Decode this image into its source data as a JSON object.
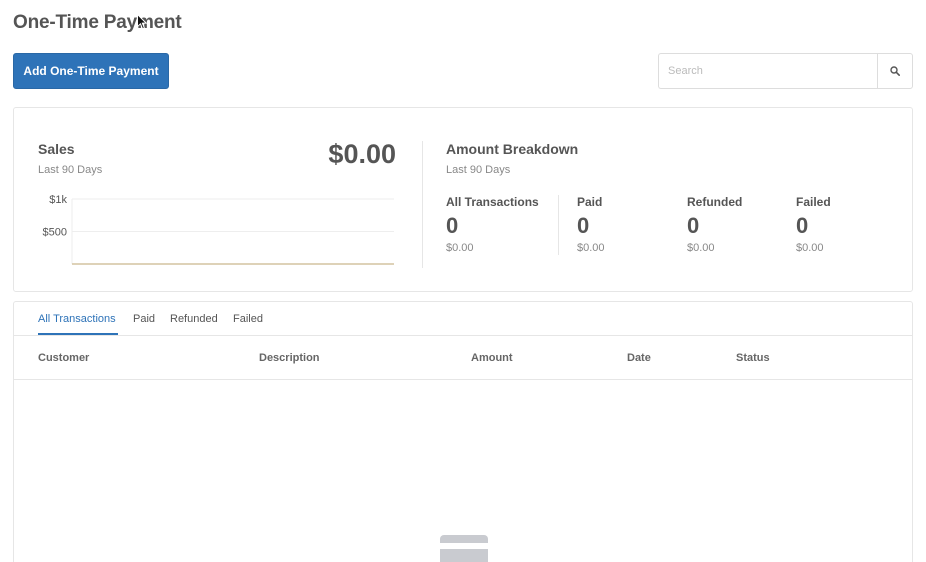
{
  "page": {
    "title": "One-Time Payment"
  },
  "toolbar": {
    "add_label": "Add One-Time Payment"
  },
  "search": {
    "placeholder": "Search",
    "value": ""
  },
  "sales": {
    "title": "Sales",
    "subtitle": "Last 90 Days",
    "total": "$0.00"
  },
  "chart_data": {
    "type": "line",
    "title": "",
    "xlabel": "",
    "ylabel": "",
    "y_tick_labels": [
      "$1k",
      "$500"
    ],
    "y_ticks": [
      1000,
      500
    ],
    "ylim": [
      0,
      1000
    ],
    "series": [
      {
        "values": [
          0,
          0
        ]
      }
    ],
    "grid": true,
    "line_color": "#d4c4a0",
    "grid_color": "#eeeeee"
  },
  "breakdown": {
    "title": "Amount Breakdown",
    "subtitle": "Last 90 Days",
    "stats": [
      {
        "label": "All Transactions",
        "count": "0",
        "amount": "$0.00"
      },
      {
        "label": "Paid",
        "count": "0",
        "amount": "$0.00"
      },
      {
        "label": "Refunded",
        "count": "0",
        "amount": "$0.00"
      },
      {
        "label": "Failed",
        "count": "0",
        "amount": "$0.00"
      }
    ]
  },
  "tabs": [
    {
      "label": "All Transactions",
      "active": true
    },
    {
      "label": "Paid",
      "active": false
    },
    {
      "label": "Refunded",
      "active": false
    },
    {
      "label": "Failed",
      "active": false
    }
  ],
  "table": {
    "columns": [
      "Customer",
      "Description",
      "Amount",
      "Date",
      "Status"
    ]
  },
  "colors": {
    "accent": "#2e73b8",
    "text": "#555555",
    "muted": "#888888",
    "border": "#e6e6e6"
  },
  "icons": {
    "search": "search-icon",
    "empty": "credit-card-icon",
    "cursor": "mouse-cursor-icon"
  }
}
